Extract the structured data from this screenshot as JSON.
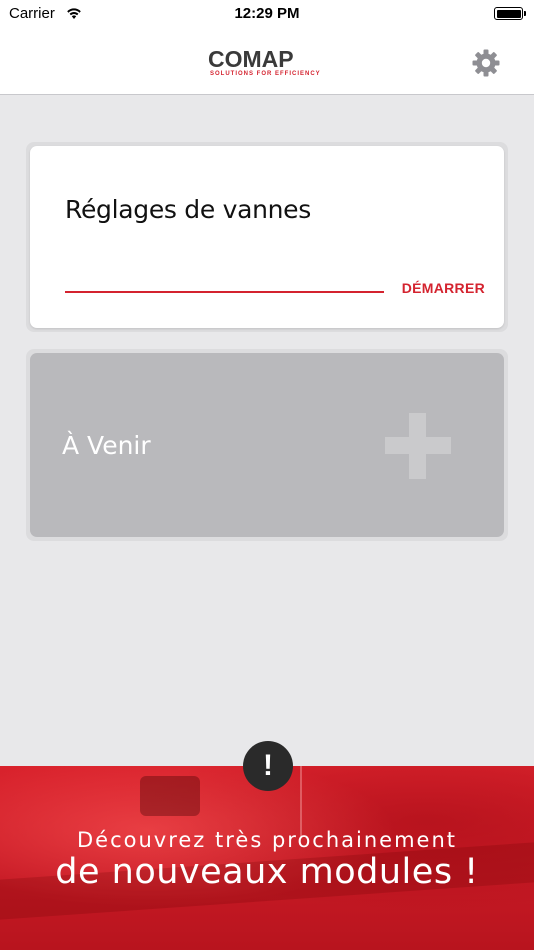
{
  "status_bar": {
    "carrier": "Carrier",
    "time": "12:29 PM",
    "wifi_icon": "wifi-icon",
    "battery_icon": "battery-icon",
    "battery_level": 1.0
  },
  "nav": {
    "logo_text": "COMAP",
    "logo_tagline": "SOLUTIONS FOR EFFICIENCY",
    "settings_icon": "gear-icon"
  },
  "modules": [
    {
      "title": "Réglages de vannes",
      "action_label": "DÉMARRER",
      "enabled": true
    },
    {
      "title": "À Venir",
      "icon": "plus-icon",
      "enabled": false
    }
  ],
  "banner": {
    "badge_glyph": "!",
    "line1": "Découvrez très prochainement",
    "line2": "de nouveaux modules !"
  },
  "colors": {
    "accent": "#d4232f",
    "background": "#e8e8ea",
    "disabled_card": "#b9b9bc"
  }
}
